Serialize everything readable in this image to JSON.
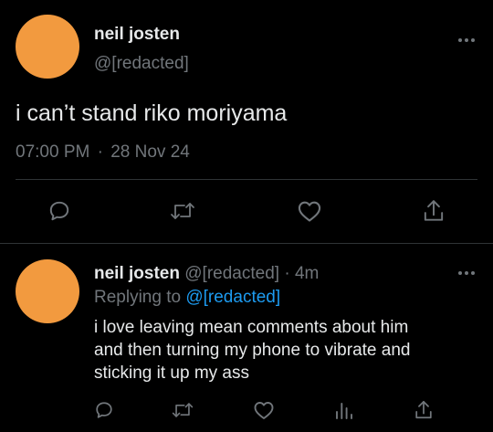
{
  "colors": {
    "background": "#000000",
    "avatar": "#f29a3f",
    "text": "#e7e9ea",
    "muted": "#71767b",
    "link": "#1d9bf0",
    "divider": "#2f3336"
  },
  "main_tweet": {
    "display_name": "neil josten",
    "handle": "@[redacted]",
    "text": "i can’t stand riko moriyama",
    "time": "07:00 PM",
    "separator": "·",
    "date": "28 Nov 24",
    "more_icon": "more-horizontal-icon",
    "actions": [
      {
        "name": "reply",
        "icon": "reply-icon"
      },
      {
        "name": "retweet",
        "icon": "retweet-icon"
      },
      {
        "name": "like",
        "icon": "heart-icon"
      },
      {
        "name": "share",
        "icon": "share-icon"
      }
    ]
  },
  "reply_tweet": {
    "display_name": "neil josten",
    "handle": "@[redacted]",
    "separator": "·",
    "age": "4m",
    "replying_to_label": "Replying to",
    "replying_to_handle": "@[redacted]",
    "text_lines": [
      "i love leaving mean comments about him",
      "and then turning my phone to vibrate and",
      "sticking it up my ass"
    ],
    "more_icon": "more-horizontal-icon",
    "actions": [
      {
        "name": "reply",
        "icon": "reply-icon"
      },
      {
        "name": "retweet",
        "icon": "retweet-icon"
      },
      {
        "name": "like",
        "icon": "heart-icon"
      },
      {
        "name": "analytics",
        "icon": "analytics-icon"
      },
      {
        "name": "share",
        "icon": "share-icon"
      }
    ]
  }
}
